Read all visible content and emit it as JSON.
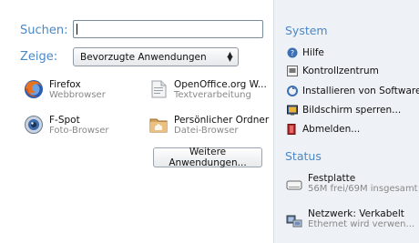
{
  "search": {
    "label": "Suchen:",
    "value": "",
    "placeholder": ""
  },
  "filter": {
    "label": "Zeige:",
    "selected": "Bevorzugte Anwendungen"
  },
  "apps": [
    {
      "name": "Firefox",
      "desc": "Webbrowser",
      "icon": "firefox-icon"
    },
    {
      "name": "OpenOffice.org W...",
      "desc": "Textverarbeitung",
      "icon": "openoffice-writer-icon"
    },
    {
      "name": "F-Spot",
      "desc": "Foto-Browser",
      "icon": "f-spot-icon"
    },
    {
      "name": "Persönlicher Ordner",
      "desc": "Datei-Browser",
      "icon": "home-folder-icon"
    }
  ],
  "more_button": "Weitere Anwendungen...",
  "system": {
    "title": "System",
    "items": [
      {
        "label": "Hilfe",
        "icon": "help-icon"
      },
      {
        "label": "Kontrollzentrum",
        "icon": "control-center-icon"
      },
      {
        "label": "Installieren von Software",
        "icon": "install-software-icon"
      },
      {
        "label": "Bildschirm sperren...",
        "icon": "lock-screen-icon"
      },
      {
        "label": "Abmelden...",
        "icon": "logout-icon"
      }
    ]
  },
  "status": {
    "title": "Status",
    "items": [
      {
        "name": "Festplatte",
        "desc": "56M frei/69M insgesamt",
        "icon": "harddisk-icon"
      },
      {
        "name": "Netzwerk: Verkabelt",
        "desc": "Ethernet wird verwen...",
        "icon": "network-wired-icon"
      }
    ]
  },
  "colors": {
    "accent": "#4a88c8",
    "pane": "#eef1f5",
    "muted": "#888888"
  }
}
